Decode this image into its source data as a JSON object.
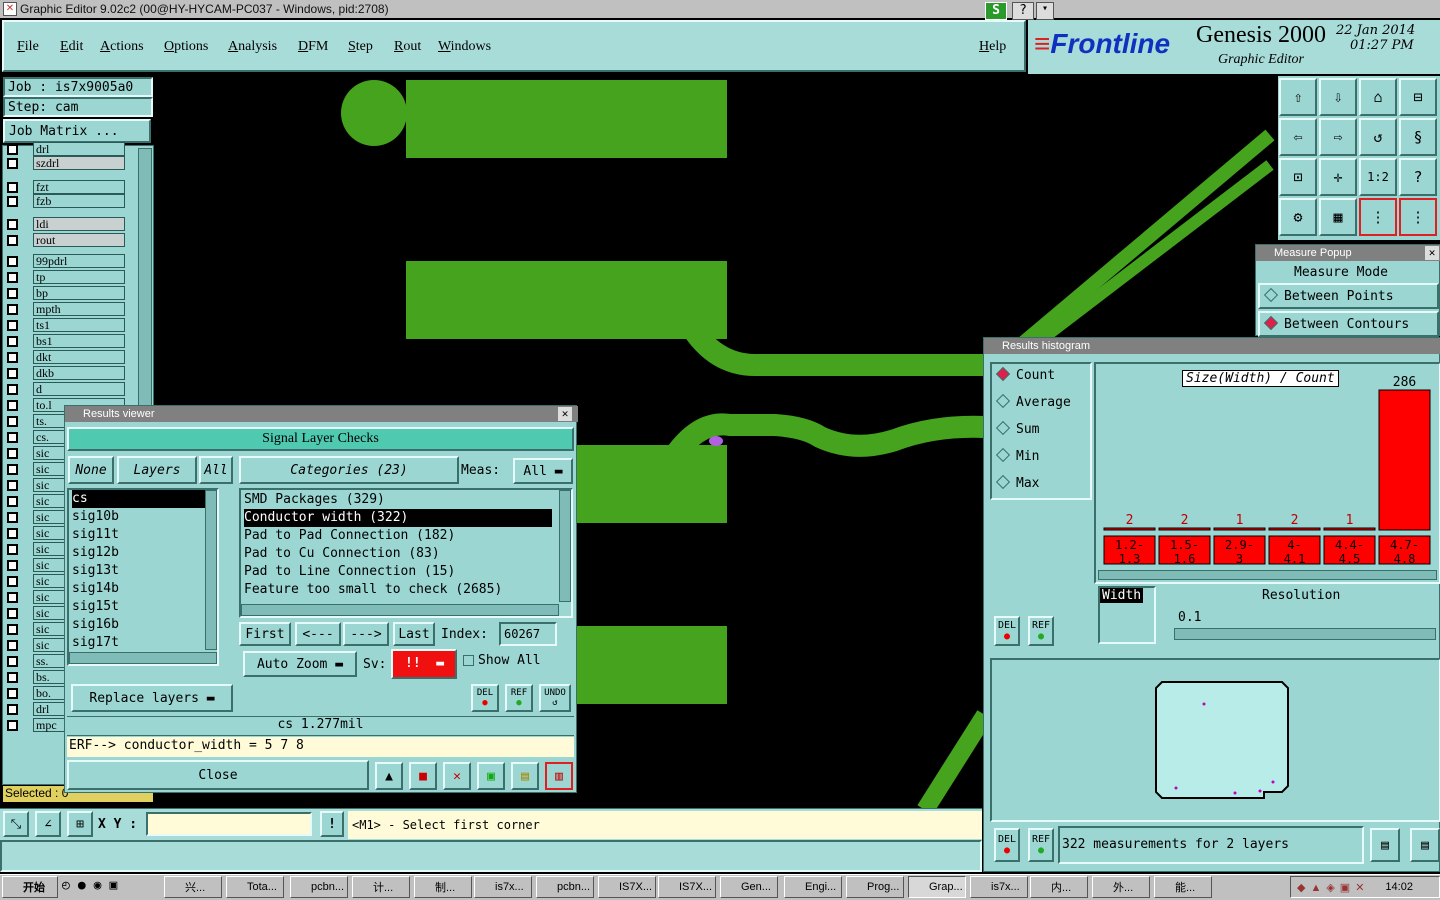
{
  "window": {
    "title": "Graphic Editor 9.02c2 (00@HY-HYCAM-PC037 - Windows, pid:2708)"
  },
  "menu": [
    "File",
    "Edit",
    "Actions",
    "Options",
    "Analysis",
    "DFM",
    "Step",
    "Rout",
    "Windows"
  ],
  "help": "Help",
  "brand": {
    "logo": "Frontline",
    "product": "Genesis 2000",
    "subtitle": "Graphic Editor",
    "date": "22 Jan 2014",
    "time": "01:27 PM"
  },
  "job": {
    "job_label": "Job : is7x9005a0",
    "step_label": "Step: cam",
    "matrix_button": "Job Matrix ..."
  },
  "layers": [
    "drl",
    "szdrl",
    "fzt",
    "fzb",
    "ldi",
    "rout",
    "99pdrl",
    "tp",
    "bp",
    "mpth",
    "ts1",
    "bs1",
    "dkt",
    "dkb",
    "d",
    "to.l",
    "ts.",
    "cs.",
    "sic",
    "sic",
    "sic",
    "sic",
    "sic",
    "sic",
    "sic",
    "sic",
    "sic",
    "sic",
    "sic",
    "sic",
    "sic",
    "ss.",
    "bs.",
    "bo.",
    "drl",
    "mpc"
  ],
  "selected_label": "Selected : 0",
  "coords": {
    "label": "X Y :",
    "value": ""
  },
  "prompt": "<M1> - Select first corner",
  "results_viewer": {
    "title": "Results viewer",
    "heading": "Signal Layer Checks",
    "none_btn": "None",
    "layers_btn": "Layers",
    "all_btn": "All",
    "categories_btn": "Categories (23)",
    "meas_label": "Meas:",
    "meas_value": "All",
    "layer_list": [
      "cs",
      "sig10b",
      "sig11t",
      "sig12b",
      "sig13t",
      "sig14b",
      "sig15t",
      "sig16b",
      "sig17t"
    ],
    "category_list": [
      "SMD Packages (329)",
      "Conductor width (322)",
      "Pad to Pad Connection (182)",
      "Pad to Cu Connection (83)",
      "Pad to Line Connection (15)",
      "Feature too small to check (2685)"
    ],
    "first": "First",
    "prev": "<---",
    "next": "--->",
    "last": "Last",
    "index_label": "Index:",
    "index_value": "60267",
    "auto_zoom": "Auto Zoom",
    "sv_label": "Sv:",
    "sv_value": "!!",
    "show_all": "Show All",
    "replace_layers": "Replace layers",
    "del": "DEL",
    "ref": "REF",
    "undo": "UNDO",
    "status": "cs 1.277mil",
    "erf": "ERF--> conductor_width = 5 7 8",
    "close": "Close"
  },
  "measure_popup": {
    "title": "Measure Popup",
    "mode": "Measure Mode",
    "opt1": "Between Points",
    "opt2": "Between Contours"
  },
  "histogram": {
    "title": "Results histogram",
    "modes": [
      "Count",
      "Average",
      "Sum",
      "Min",
      "Max"
    ],
    "chart_title": "Size(Width) / Count",
    "bins": [
      {
        "label": "1.2- 1.3",
        "count": 2
      },
      {
        "label": "1.5- 1.6",
        "count": 2
      },
      {
        "label": "2.9- 3",
        "count": 1
      },
      {
        "label": "4- 4.1",
        "count": 2
      },
      {
        "label": "4.4- 4.5",
        "count": 1
      },
      {
        "label": "4.7- 4.8",
        "count": 286
      }
    ],
    "width_label": "Width",
    "resolution_label": "Resolution",
    "resolution_value": "0.1",
    "del": "DEL",
    "ref": "REF",
    "footer": "322 measurements for 2 layers"
  },
  "taskbar": {
    "start": "开始",
    "items": [
      "兴...",
      "Tota...",
      "pcbn...",
      "计...",
      "制...",
      "is7x...",
      "pcbn...",
      "IS7X...",
      "IS7X...",
      "Gen...",
      "Engi...",
      "Prog...",
      "Grap...",
      "is7x...",
      "内...",
      "外...",
      "能..."
    ],
    "clock": "14:02"
  },
  "colors": {
    "panel": "#9bd6d2",
    "copper": "#45a31d",
    "highlight": "#ff0000"
  }
}
